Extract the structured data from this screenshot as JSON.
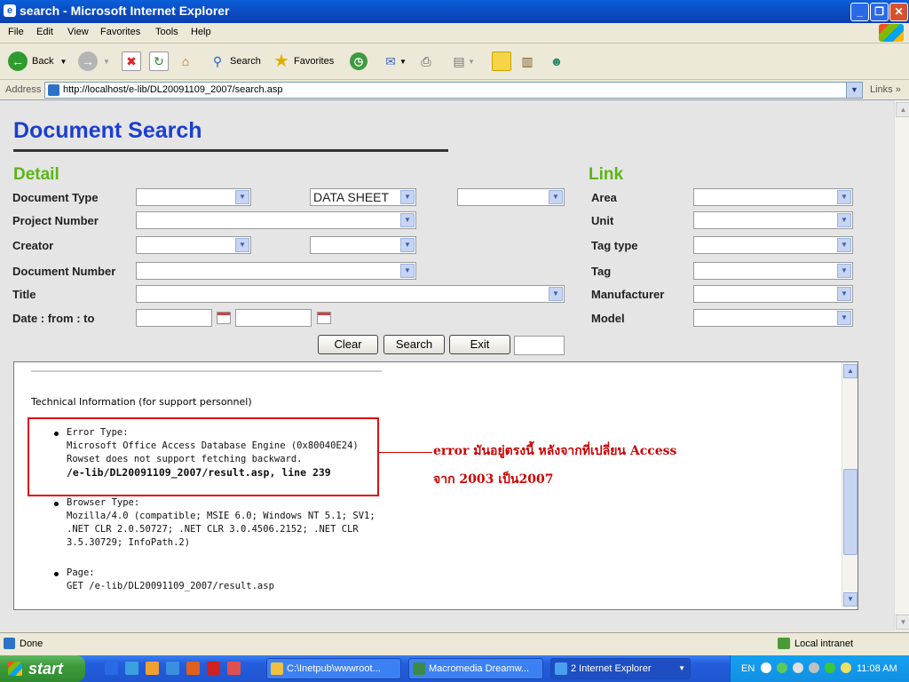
{
  "window": {
    "title": "search - Microsoft Internet Explorer"
  },
  "menu": [
    "File",
    "Edit",
    "View",
    "Favorites",
    "Tools",
    "Help"
  ],
  "toolbar": {
    "back": "Back",
    "search": "Search",
    "favorites": "Favorites"
  },
  "address": {
    "label": "Address",
    "url": "http://localhost/e-lib/DL20091109_2007/search.asp",
    "links": "Links"
  },
  "page": {
    "title": "Document Search",
    "detail_heading": "Detail",
    "link_heading": "Link",
    "labels": {
      "doc_type": "Document Type",
      "project_number": "Project Number",
      "creator": "Creator",
      "doc_number": "Document Number",
      "title": "Title",
      "date": "Date : from : to"
    },
    "doc_type_value": "DATA SHEET",
    "link_labels": {
      "area": "Area",
      "unit": "Unit",
      "tag_type": "Tag type",
      "tag": "Tag",
      "manufacturer": "Manufacturer",
      "model": "Model"
    },
    "buttons": {
      "clear": "Clear",
      "search": "Search",
      "exit": "Exit"
    }
  },
  "error_frame": {
    "tech_info": "Technical Information (for support personnel)",
    "error_type_label": "Error Type:",
    "error_lines": [
      "Microsoft Office Access Database Engine (0x80040E24)",
      "Rowset does not support fetching backward."
    ],
    "error_location": "/e-lib/DL20091109_2007/result.asp, line 239",
    "browser_type_label": "Browser Type:",
    "browser_lines": [
      "Mozilla/4.0 (compatible; MSIE 6.0; Windows NT 5.1; SV1;",
      ".NET CLR 2.0.50727; .NET CLR 3.0.4506.2152; .NET CLR",
      "3.5.30729; InfoPath.2)"
    ],
    "page_label": "Page:",
    "page_value": "GET /e-lib/DL20091109_2007/result.asp",
    "annotation_line1": "error มันอยู่ตรงนี้ หลังจากที่เปลี่ยน Access",
    "annotation_line2": "จาก 2003 เป็น2007"
  },
  "status": {
    "text": "Done",
    "zone": "Local intranet"
  },
  "taskbar": {
    "start": "start",
    "tasks": [
      "C:\\Inetpub\\wwwroot...",
      "Macromedia Dreamw...",
      "2 Internet Explorer"
    ],
    "lang": "EN",
    "clock": "11:08 AM"
  },
  "colors": {
    "heading_blue": "#1b3fd0",
    "section_green": "#5cb516",
    "error_red": "#cc0000"
  }
}
